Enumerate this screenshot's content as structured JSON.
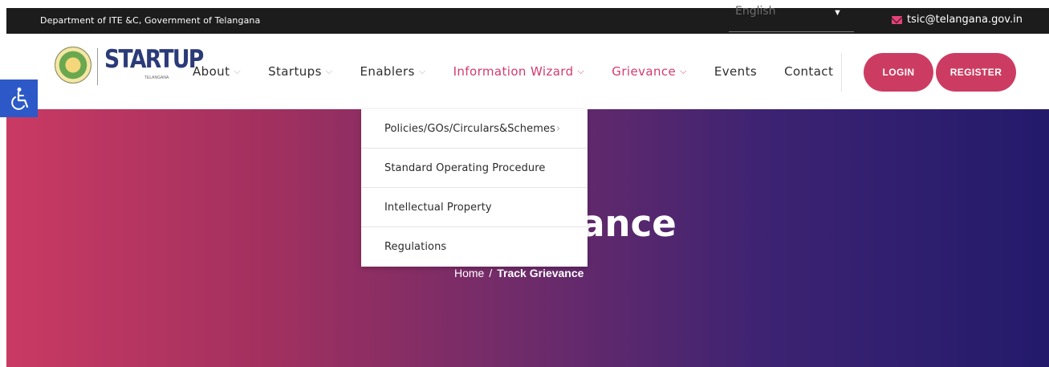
{
  "topbar": {
    "department": "Department of ITE &C, Government of Telangana",
    "language": "English",
    "email": "tsic@telangana.gov.in"
  },
  "brand": {
    "logo_text": "STARTUP",
    "logo_subtext": "TELANGANA"
  },
  "nav": {
    "items": [
      {
        "label": "About"
      },
      {
        "label": "Startups"
      },
      {
        "label": "Enablers"
      },
      {
        "label": "Information Wizard"
      },
      {
        "label": "Grievance"
      },
      {
        "label": "Events"
      },
      {
        "label": "Contact"
      }
    ],
    "login_label": "LOGIN",
    "register_label": "REGISTER"
  },
  "dropdown": {
    "items": [
      {
        "label": "Policies/GOs/Circulars&Schemes"
      },
      {
        "label": "Standard Operating Procedure"
      },
      {
        "label": "Intellectual Property"
      },
      {
        "label": "Regulations"
      }
    ]
  },
  "hero": {
    "title_visible": "ance",
    "breadcrumb_home": "Home",
    "breadcrumb_sep": "/",
    "breadcrumb_current": "Track Grievance"
  },
  "colors": {
    "accent_pink": "#d23a6e",
    "button": "#cc3c62",
    "topbar": "#1c1c1c",
    "accessibility": "#2d59c8"
  },
  "icons": {
    "accessibility": "wheelchair-icon",
    "email": "envelope-icon",
    "chevron": "chevron-down-icon"
  }
}
